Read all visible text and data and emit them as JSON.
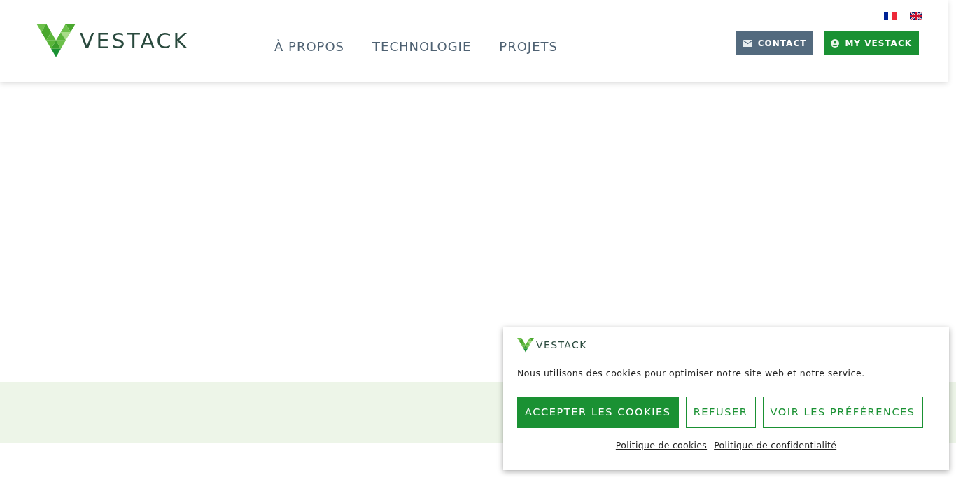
{
  "header": {
    "logo": "VESTACK",
    "nav": [
      "À PROPOS",
      "TECHNOLOGIE",
      "PROJETS"
    ],
    "actions": [
      {
        "label": "CONTACT",
        "kind": "contact"
      },
      {
        "label": "MY VESTACK",
        "kind": "account"
      }
    ]
  },
  "cookie_banner": {
    "logo": "VESTACK",
    "message": "Nous utilisons des cookies pour optimiser notre site web et notre service.",
    "buttons": [
      {
        "label": "ACCEPTER LES COOKIES",
        "kind": "filled"
      },
      {
        "label": "REFUSER",
        "kind": "outline"
      },
      {
        "label": "VOIR LES PRÉFÉRENCES",
        "kind": "outline"
      }
    ],
    "links": [
      "Politique de cookies",
      "Politique de confidentialité"
    ]
  }
}
